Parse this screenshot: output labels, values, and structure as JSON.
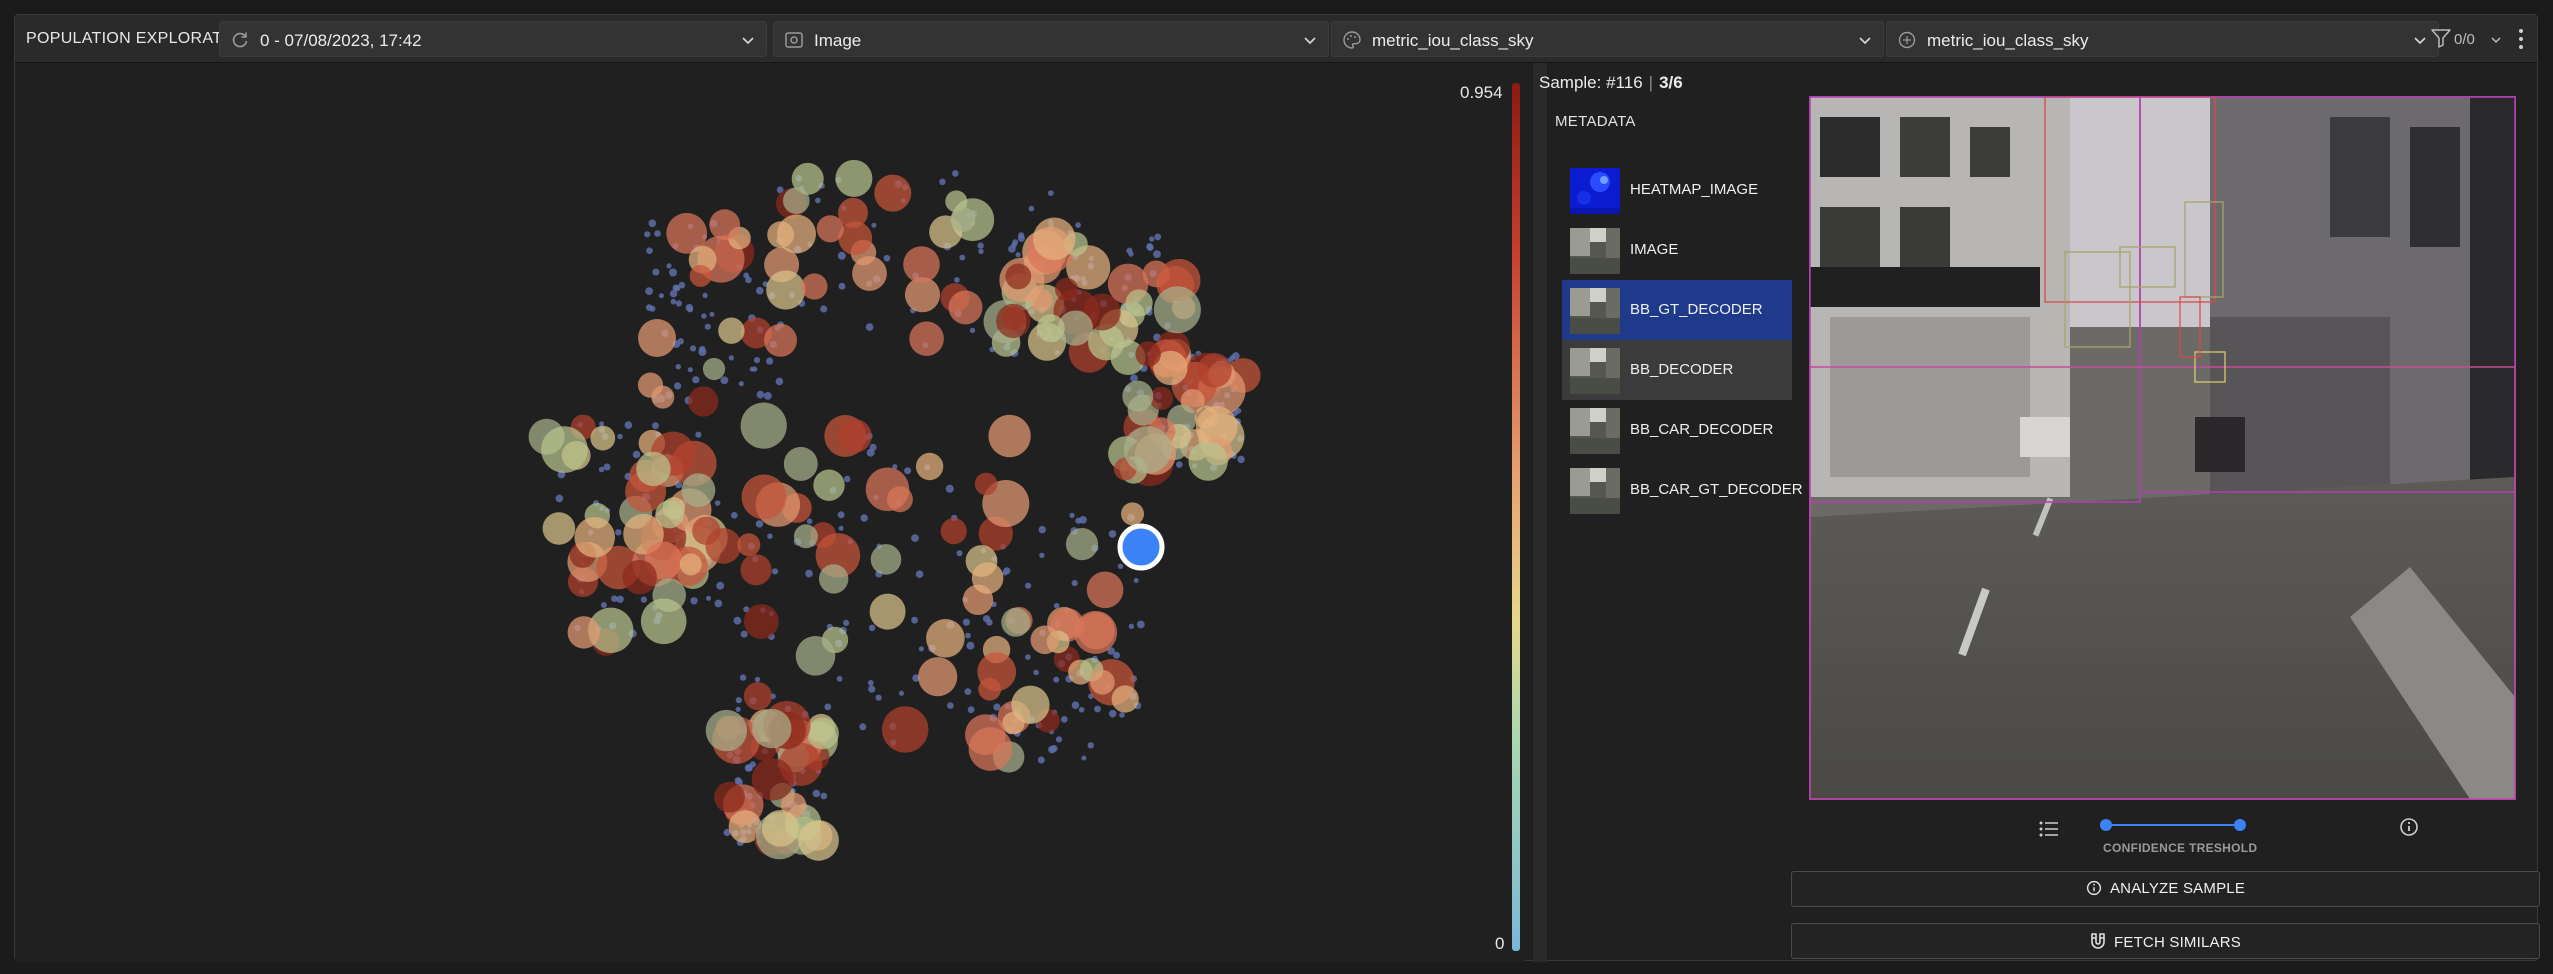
{
  "app": {
    "title": "POPULATION EXPLORATION"
  },
  "toolbar": {
    "version_dropdown": {
      "value": "0 - 07/08/2023, 17:42",
      "icon": "refresh-icon"
    },
    "input_dropdown": {
      "value": "Image",
      "icon": "image-icon"
    },
    "color_metric_dropdown": {
      "value": "metric_iou_class_sky",
      "icon": "palette-icon"
    },
    "size_metric_dropdown": {
      "value": "metric_iou_class_sky",
      "icon": "size-icon"
    },
    "filter": {
      "count": "0/0",
      "icon": "filter-icon"
    }
  },
  "colorbar": {
    "max_label": "0.954",
    "min_label": "0",
    "colors": [
      "#8e1a10",
      "#c8402e",
      "#e8a070",
      "#e7d88a",
      "#a8d8b0",
      "#7ab8d8"
    ]
  },
  "sample": {
    "label": "Sample: #116",
    "index": "3/6"
  },
  "metadata": {
    "title": "METADATA",
    "items": [
      {
        "name": "HEATMAP_IMAGE",
        "state": "normal"
      },
      {
        "name": "IMAGE",
        "state": "normal"
      },
      {
        "name": "BB_GT_DECODER",
        "state": "selected"
      },
      {
        "name": "BB_DECODER",
        "state": "hover"
      },
      {
        "name": "BB_CAR_DECODER",
        "state": "normal"
      },
      {
        "name": "BB_CAR_GT_DECODER",
        "state": "normal"
      }
    ]
  },
  "confidence": {
    "label": "CONFIDENCE TRESHOLD",
    "low": 0,
    "high": 1
  },
  "actions": {
    "analyze": "ANALYZE SAMPLE",
    "fetch": "FETCH SIMILARS"
  },
  "accent_color": "#3b82f6",
  "selection_color": "#1f3a8a"
}
